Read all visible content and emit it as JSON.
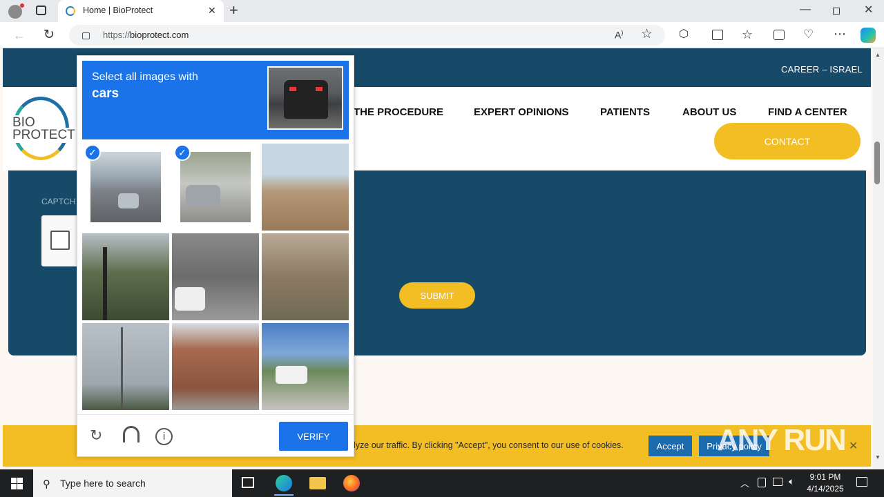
{
  "browser": {
    "tab_title": "Home | BioProtect",
    "url_prefix": "https://",
    "url_domain": "bioprotect.com",
    "new_tab": "+"
  },
  "site": {
    "topbar_link": "CAREER – ISRAEL",
    "logo_line1": "BIO",
    "logo_line2": "PROTECT",
    "nav": [
      "THE PROCEDURE",
      "EXPERT OPINIONS",
      "PATIENTS",
      "ABOUT US",
      "FIND A CENTER"
    ],
    "contact": "CONTACT",
    "captcha_label": "CAPTCH",
    "submit": "SUBMIT",
    "cookie_text": "lyze our traffic. By clicking \"Accept\", you consent to our use of cookies.",
    "accept": "Accept",
    "privacy": "Privacy policy"
  },
  "captcha": {
    "prompt": "Select all images with",
    "target": "cars",
    "tiles": [
      {
        "selected": true,
        "desc": "highway cars"
      },
      {
        "selected": true,
        "desc": "street cars"
      },
      {
        "selected": false,
        "desc": "building traffic light"
      },
      {
        "selected": false,
        "desc": "traffic light trees"
      },
      {
        "selected": false,
        "desc": "overpass car"
      },
      {
        "selected": false,
        "desc": "alley plants"
      },
      {
        "selected": false,
        "desc": "pole sky"
      },
      {
        "selected": false,
        "desc": "brick building"
      },
      {
        "selected": false,
        "desc": "fountain van"
      }
    ],
    "verify": "VERIFY"
  },
  "taskbar": {
    "search_placeholder": "Type here to search",
    "time": "9:01 PM",
    "date": "4/14/2025"
  },
  "watermark": "ANY RUN",
  "colors": {
    "site_blue": "#174a68",
    "site_yellow": "#f3bd24",
    "hcaptcha_blue": "#1a73e8"
  }
}
